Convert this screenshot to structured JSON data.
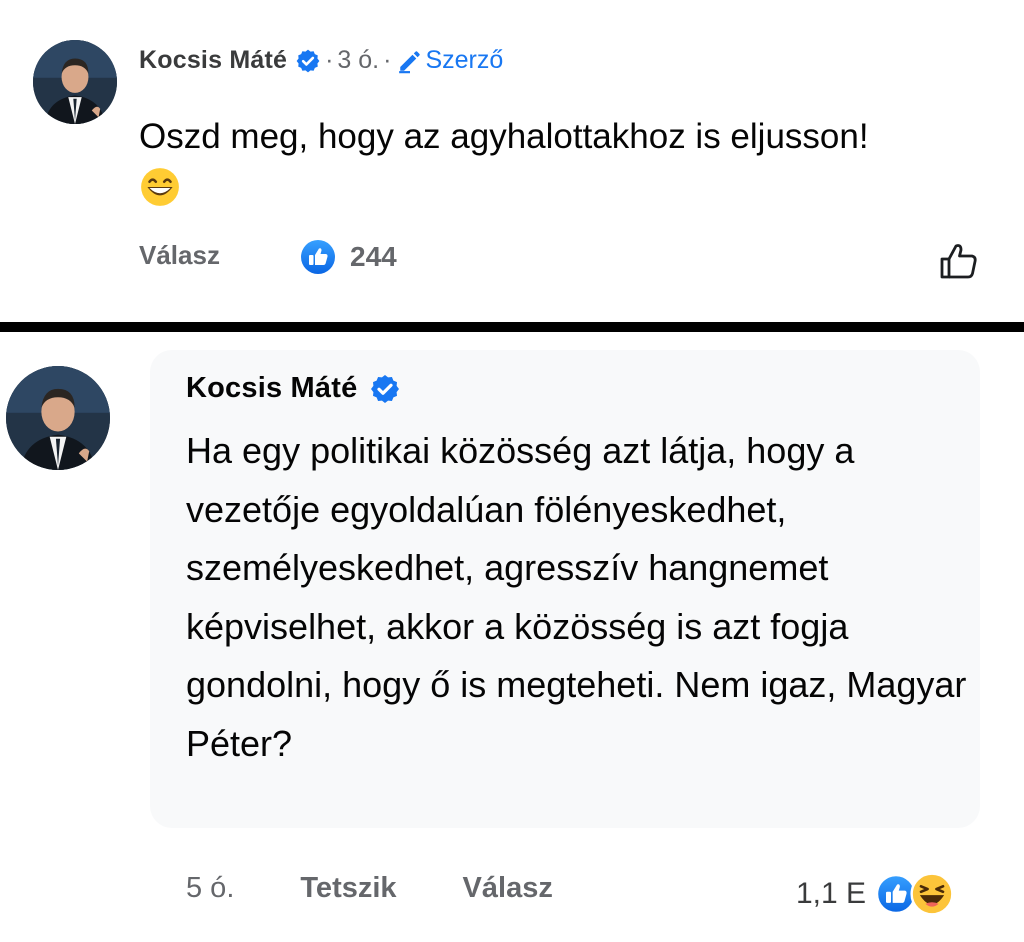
{
  "comments": [
    {
      "author": "Kocsis Máté",
      "time": "3 ó.",
      "badge": "Szerző",
      "text": "Oszd meg, hogy az agyhalottakhoz is eljusson!",
      "emoji": "grinning-face-with-smiling-eyes",
      "reply_label": "Válasz",
      "reaction_count": "244",
      "reaction_type": "like"
    },
    {
      "author": "Kocsis Máté",
      "text": "Ha egy politikai közösség azt látja, hogy a vezetője egyoldalúan fölényeskedhet, személyeskedhet, agresszív hangnemet képviselhet, akkor a közösség is azt fogja gondolni, hogy ő is megteheti. Nem igaz, Magyar Péter?",
      "time": "5 ó.",
      "like_label": "Tetszik",
      "reply_label": "Válasz",
      "reaction_count": "1,1 E",
      "reaction_types": [
        "like",
        "haha"
      ]
    }
  ],
  "colors": {
    "accent": "#1877f2",
    "meta_text": "#65676b",
    "body_text": "#050505",
    "divider": "#000000"
  },
  "icons": [
    "verified-badge-icon",
    "pencil-icon",
    "like-reaction-icon",
    "haha-reaction-icon",
    "thumbs-up-outline-icon"
  ]
}
